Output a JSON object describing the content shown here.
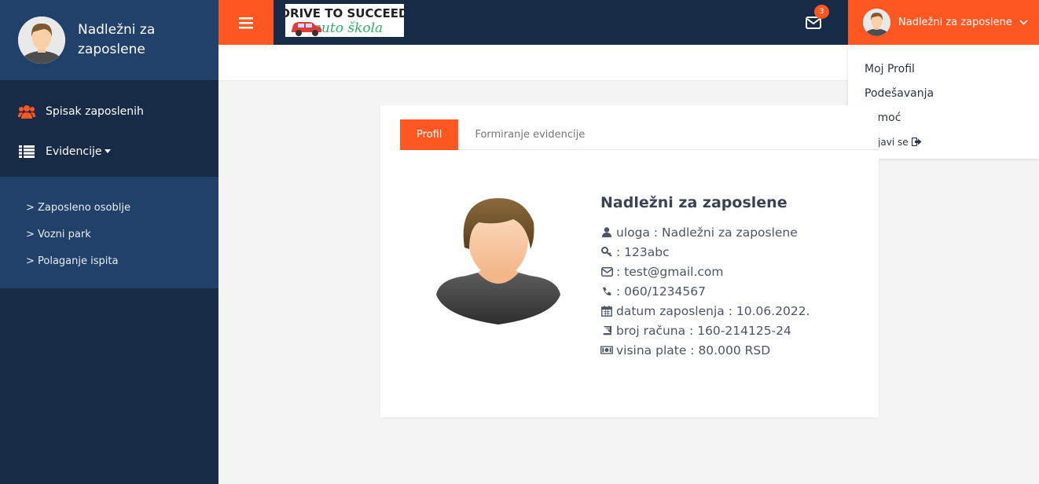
{
  "sidebar": {
    "user_name": "Nadležni za zaposlene",
    "menu": [
      {
        "label": "Spisak zaposlenih",
        "icon": "users-icon"
      },
      {
        "label": "Evidencije",
        "icon": "list-icon"
      }
    ],
    "submenu": [
      "> Zaposleno osoblje",
      "> Vozni park",
      "> Polaganje ispita"
    ]
  },
  "topbar": {
    "menu_icon": "hamburger-icon",
    "logo_line1": "DRIVE TO SUCCEED",
    "logo_line2": "auto škola",
    "mail_badge": "3",
    "user_name": "Nadležni za zaposlene"
  },
  "dropdown": {
    "items": [
      "Moj Profil",
      "Podešavanja",
      "Pomoć",
      "Odjavi se"
    ]
  },
  "card": {
    "tabs": [
      "Profil",
      "Formiranje evidencije"
    ],
    "name": "Nadležni za zaposlene",
    "rows": [
      {
        "icon": "user-icon",
        "text": "uloga : Nadležni za zaposlene"
      },
      {
        "icon": "key-icon",
        "text": ": 123abc"
      },
      {
        "icon": "envelope-icon",
        "text": ": test@gmail.com"
      },
      {
        "icon": "phone-icon",
        "text": ": 060/1234567"
      },
      {
        "icon": "calendar-icon",
        "text": "datum zaposlenja : 10.06.2022."
      },
      {
        "icon": "book-icon",
        "text": "broj računa : 160-214125-24"
      },
      {
        "icon": "money-icon",
        "text": "visina plate : 80.000 RSD"
      }
    ]
  },
  "colors": {
    "accent": "#ff5722",
    "sidebar_bg": "#172a46",
    "sidebar_light": "#22416a"
  }
}
